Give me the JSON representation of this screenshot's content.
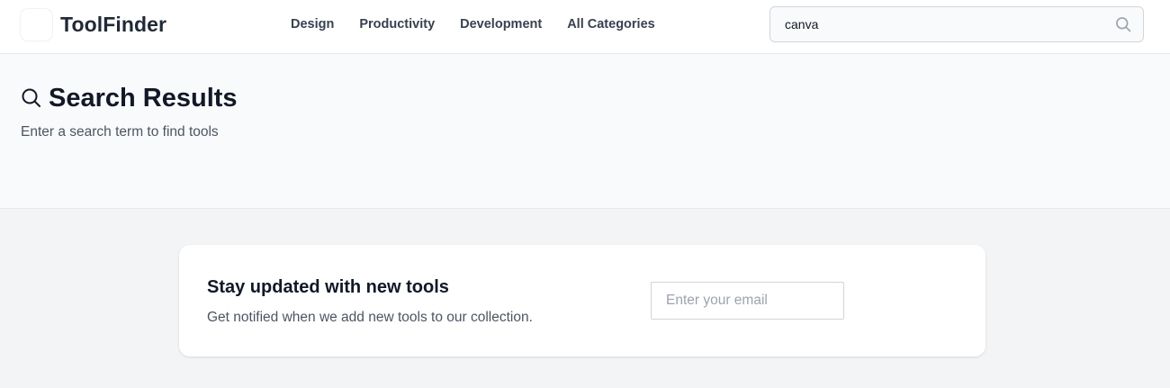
{
  "header": {
    "brand": "ToolFinder",
    "nav": [
      "Design",
      "Productivity",
      "Development",
      "All Categories"
    ],
    "search": {
      "value": "canva",
      "icon": "search-icon"
    }
  },
  "hero": {
    "icon": "search-icon",
    "title": "Search Results",
    "subtitle": "Enter a search term to find tools"
  },
  "newsletter": {
    "title": "Stay updated with new tools",
    "subtitle": "Get notified when we add new tools to our collection.",
    "email_placeholder": "Enter your email"
  }
}
